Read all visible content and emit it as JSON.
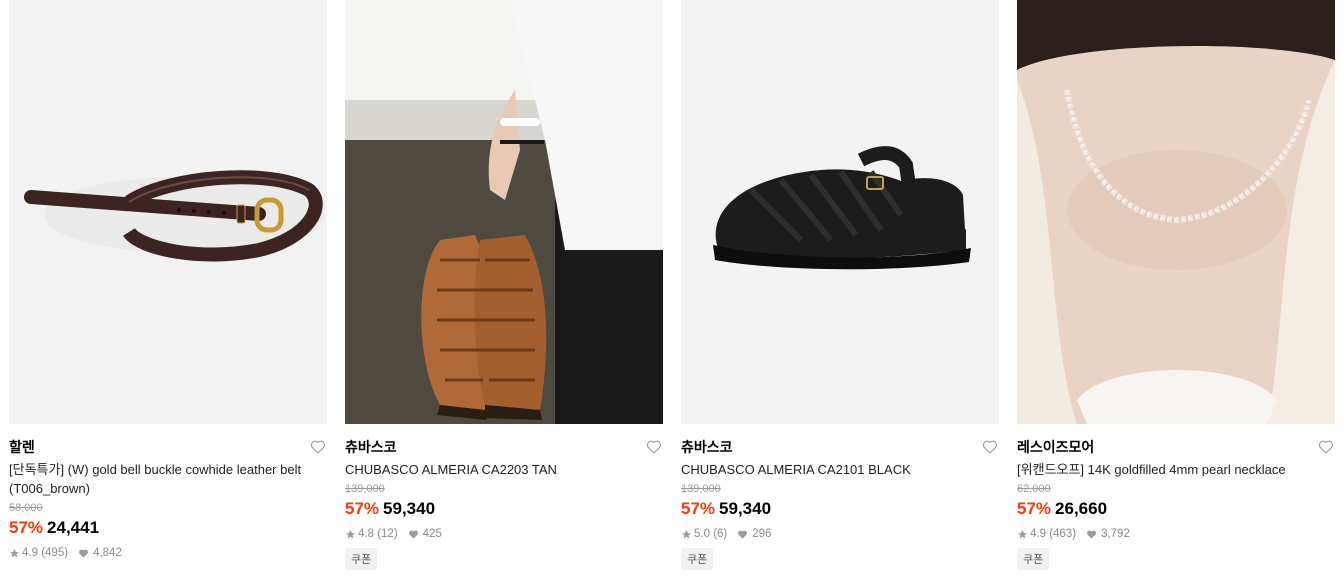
{
  "products": [
    {
      "brand": "할렌",
      "title": "[단독특가] (W) gold bell buckle cowhide leather belt (T006_brown)",
      "original_price": "58,000",
      "discount": "57%",
      "price": "24,441",
      "rating": "4.9",
      "reviews": "(495)",
      "likes": "4,842",
      "badge": null
    },
    {
      "brand": "츄바스코",
      "title": "CHUBASCO ALMERIA CA2203 TAN",
      "original_price": "139,000",
      "discount": "57%",
      "price": "59,340",
      "rating": "4.8",
      "reviews": "(12)",
      "likes": "425",
      "badge": "쿠폰"
    },
    {
      "brand": "츄바스코",
      "title": "CHUBASCO ALMERIA CA2101 BLACK",
      "original_price": "139,000",
      "discount": "57%",
      "price": "59,340",
      "rating": "5.0",
      "reviews": "(6)",
      "likes": "296",
      "badge": "쿠폰"
    },
    {
      "brand": "레스이즈모어",
      "title": "[위캔드오프] 14K goldfilled 4mm pearl necklace",
      "original_price": "62,000",
      "discount": "57%",
      "price": "26,660",
      "rating": "4.9",
      "reviews": "(463)",
      "likes": "3,792",
      "badge": "쿠폰"
    }
  ],
  "colors": {
    "discount": "#ff3700",
    "muted": "#9b9b9b"
  },
  "icons": [
    "heart-outline-icon",
    "star-icon",
    "heart-filled-icon"
  ]
}
